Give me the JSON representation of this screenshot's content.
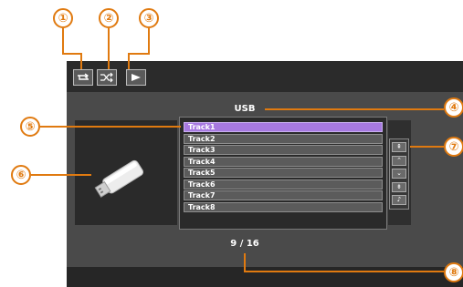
{
  "callouts": [
    "①",
    "②",
    "③",
    "④",
    "⑤",
    "⑥",
    "⑦",
    "⑧"
  ],
  "toolbar": {
    "repeat_icon": "repeat-icon",
    "shuffle_icon": "shuffle-icon",
    "play_icon": "play-icon"
  },
  "source_label": "USB",
  "usb_icon": "usb-drive-icon",
  "tracks": [
    "Track1",
    "Track2",
    "Track3",
    "Track4",
    "Track5",
    "Track6",
    "Track7",
    "Track8"
  ],
  "selected_track_index": 0,
  "nav_buttons": [
    {
      "icon": "page-up-icon",
      "glyph": "⇞"
    },
    {
      "icon": "chevron-up-icon",
      "glyph": "⌃"
    },
    {
      "icon": "chevron-down-icon",
      "glyph": "⌄"
    },
    {
      "icon": "page-down-icon",
      "glyph": "⇟"
    },
    {
      "icon": "music-note-icon",
      "glyph": "♪"
    }
  ],
  "counter": "9 / 16",
  "colors": {
    "callout": "#e07a10",
    "selected_track": "#a779e0",
    "screen_bg": "#4a4a4a"
  }
}
